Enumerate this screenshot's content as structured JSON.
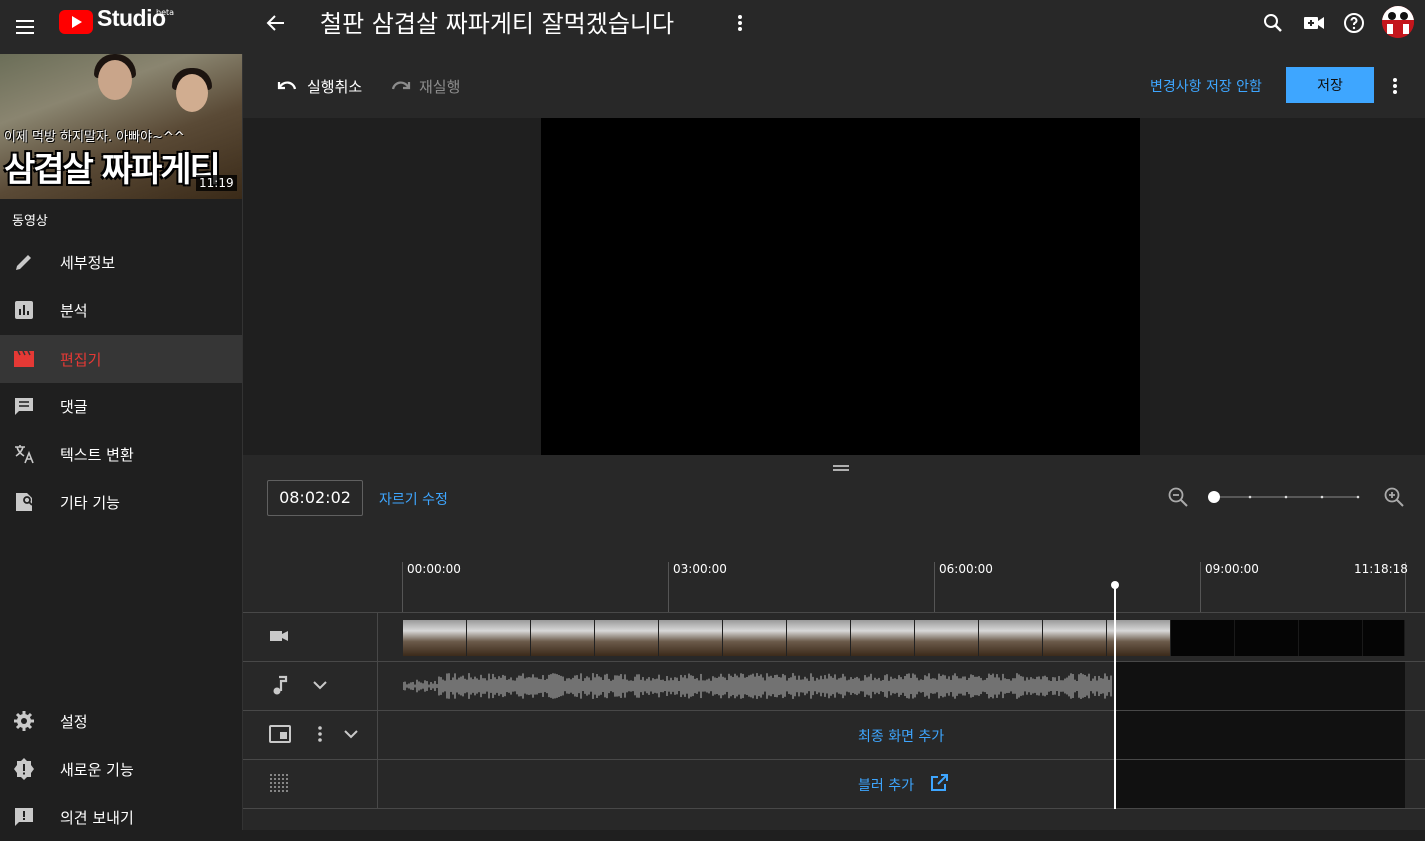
{
  "app": {
    "studio_label": "Studio",
    "beta_label": "beta"
  },
  "header": {
    "video_title": "철판 삼겹살 짜파게티 잘먹겠습니다"
  },
  "sidebar": {
    "thumbnail": {
      "caption": "이제 먹방 하지말자. 아빠야~^^",
      "big_text": "삼겹살 짜파게티",
      "duration": "11:19"
    },
    "section_label": "동영상",
    "items": [
      {
        "label": "세부정보",
        "icon": "pencil-icon"
      },
      {
        "label": "분석",
        "icon": "analytics-icon"
      },
      {
        "label": "편집기",
        "icon": "clapperboard-icon",
        "active": true
      },
      {
        "label": "댓글",
        "icon": "comment-icon"
      },
      {
        "label": "텍스트 변환",
        "icon": "translate-icon"
      },
      {
        "label": "기타 기능",
        "icon": "extra-features-icon"
      }
    ],
    "bottom_items": [
      {
        "label": "설정",
        "icon": "gear-icon"
      },
      {
        "label": "새로운 기능",
        "icon": "new-badge-icon"
      },
      {
        "label": "의견 보내기",
        "icon": "feedback-icon"
      }
    ]
  },
  "toolbar": {
    "undo_label": "실행취소",
    "redo_label": "재실행",
    "discard_label": "변경사항 저장 안함",
    "save_label": "저장"
  },
  "timeline": {
    "current_time": "08:02:02",
    "trim_label": "자르기 수정",
    "ruler": [
      "00:00:00",
      "03:00:00",
      "06:00:00",
      "09:00:00"
    ],
    "end_time": "11:18:18",
    "zoom_level_fraction": 0.0,
    "endscreen_label": "최종 화면 추가",
    "blur_label": "블러 추가"
  },
  "colors": {
    "accent": "#3ea6ff",
    "active_nav": "#e53935",
    "youtube_red": "#ff0000"
  }
}
